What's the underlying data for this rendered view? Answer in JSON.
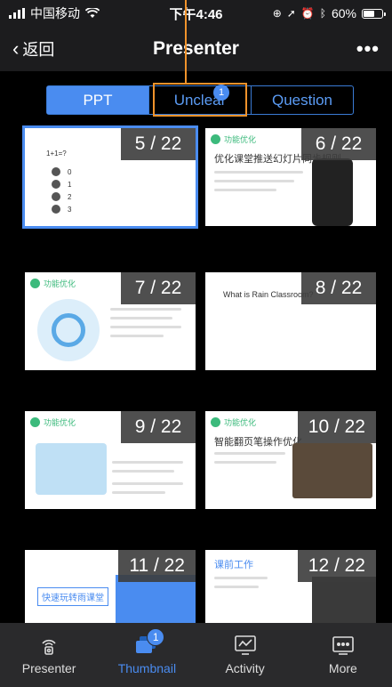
{
  "status_bar": {
    "carrier": "中国移动",
    "time": "下午4:46",
    "battery": "60%",
    "battery_level": 0.6
  },
  "nav": {
    "back_label": "返回",
    "title": "Presenter",
    "more": "•••"
  },
  "segments": [
    {
      "label": "PPT",
      "active": true
    },
    {
      "label": "Unclear",
      "badge": "1"
    },
    {
      "label": "Question"
    }
  ],
  "slides": [
    {
      "number": "5 / 22",
      "quiz_title": "1+1=?",
      "options": [
        "0",
        "1",
        "2",
        "3"
      ],
      "selected": true
    },
    {
      "number": "6 / 22",
      "tag": "功能优化",
      "heading": "优化课堂推送幻灯片同步规则"
    },
    {
      "number": "7 / 22",
      "tag": "功能优化"
    },
    {
      "number": "8 / 22",
      "heading": "What is Rain Classroom?"
    },
    {
      "number": "9 / 22",
      "tag": "功能优化"
    },
    {
      "number": "10 / 22",
      "tag": "功能优化",
      "heading": "智能翻页笔操作优化"
    },
    {
      "number": "11 / 22",
      "heading": "快速玩转雨课堂"
    },
    {
      "number": "12 / 22",
      "heading": "课前工作"
    }
  ],
  "tabs": [
    {
      "label": "Presenter",
      "icon": "presenter-icon"
    },
    {
      "label": "Thumbnail",
      "icon": "thumbnail-icon",
      "active": true,
      "badge": "1"
    },
    {
      "label": "Activity",
      "icon": "activity-icon"
    },
    {
      "label": "More",
      "icon": "more-icon"
    }
  ],
  "colors": {
    "accent": "#4a8cf0",
    "highlight": "#f0932b",
    "tag_green": "#3cba7c"
  }
}
